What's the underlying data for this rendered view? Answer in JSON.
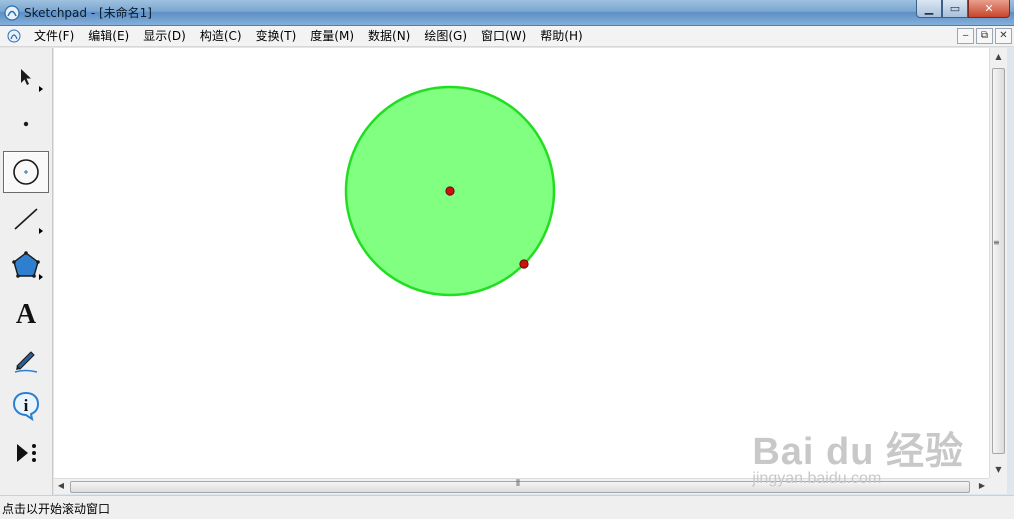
{
  "window": {
    "title": "Sketchpad  - [未命名1]",
    "buttons": {
      "minimize": "▁",
      "maximize": "▭",
      "close": "✕"
    }
  },
  "menubar": {
    "items": [
      "文件(F)",
      "编辑(E)",
      "显示(D)",
      "构造(C)",
      "变换(T)",
      "度量(M)",
      "数据(N)",
      "绘图(G)",
      "窗口(W)",
      "帮助(H)"
    ],
    "mdi_buttons": {
      "minimize": "‒",
      "restore": "⧉",
      "close": "✕"
    }
  },
  "toolbox": {
    "tools": [
      {
        "name": "arrow-tool",
        "icon": "arrow-cursor-icon",
        "selected": false,
        "has_submenu": true
      },
      {
        "name": "point-tool",
        "icon": "point-icon",
        "selected": false,
        "has_submenu": false
      },
      {
        "name": "compass-tool",
        "icon": "circle-icon",
        "selected": true,
        "has_submenu": false
      },
      {
        "name": "straightedge-tool",
        "icon": "line-segment-icon",
        "selected": false,
        "has_submenu": true
      },
      {
        "name": "polygon-tool",
        "icon": "polygon-icon",
        "selected": false,
        "has_submenu": true
      },
      {
        "name": "text-tool",
        "icon": "text-a-icon",
        "selected": false,
        "has_submenu": false
      },
      {
        "name": "marker-tool",
        "icon": "pen-icon",
        "selected": false,
        "has_submenu": false
      },
      {
        "name": "information-tool",
        "icon": "info-icon",
        "selected": false,
        "has_submenu": false
      },
      {
        "name": "custom-tool",
        "icon": "custom-tool-icon",
        "selected": false,
        "has_submenu": false
      }
    ]
  },
  "sketch": {
    "circle": {
      "fill": "#80ff80",
      "stroke": "#22dd22"
    },
    "points": [
      {
        "name": "center-point",
        "color": "#cc1111"
      },
      {
        "name": "radius-point",
        "color": "#cc1111"
      }
    ]
  },
  "statusbar": {
    "text": "点击以开始滚动窗口"
  },
  "watermark": {
    "brand": "Bai du 经验",
    "site": "jingyan.baidu.com"
  },
  "colors": {
    "accent": "#5d8fc4",
    "circle_fill": "#80ff80",
    "circle_stroke": "#22dd22",
    "point": "#cc1111"
  }
}
